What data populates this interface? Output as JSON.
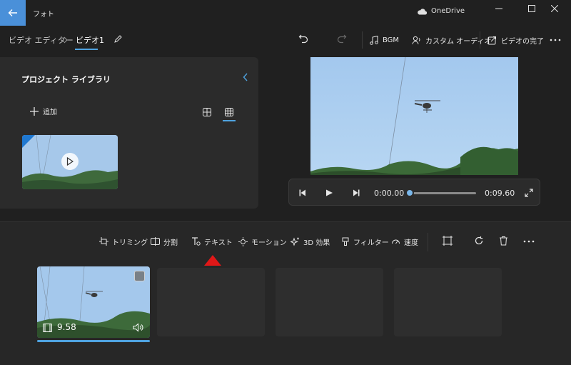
{
  "titlebar": {
    "app_title": "フォト",
    "cloud_label": "OneDrive"
  },
  "nav": {
    "crumb_root": "ビデオ エディター",
    "crumb_current": "ビデオ1",
    "bgm_label": "BGM",
    "custom_audio_label": "カスタム オーディオ",
    "finish_label": "ビデオの完了"
  },
  "library": {
    "title": "プロジェクト ライブラリ",
    "add_label": "追加"
  },
  "player": {
    "current_time": "0:00.00",
    "total_time": "0:09.60",
    "progress": 0
  },
  "toolbar": {
    "trim": "トリミング",
    "split": "分割",
    "text": "テキスト",
    "motion": "モーション",
    "effects_3d": "3D 効果",
    "filter": "フィルター",
    "speed": "速度"
  },
  "storyboard": {
    "clips": [
      {
        "duration": "9.58",
        "filled": true
      },
      {
        "filled": false
      },
      {
        "filled": false
      },
      {
        "filled": false
      }
    ]
  },
  "colors": {
    "accent": "#4fa3e0",
    "back_button": "#4a90d9",
    "annotation_arrow": "#e01818"
  }
}
